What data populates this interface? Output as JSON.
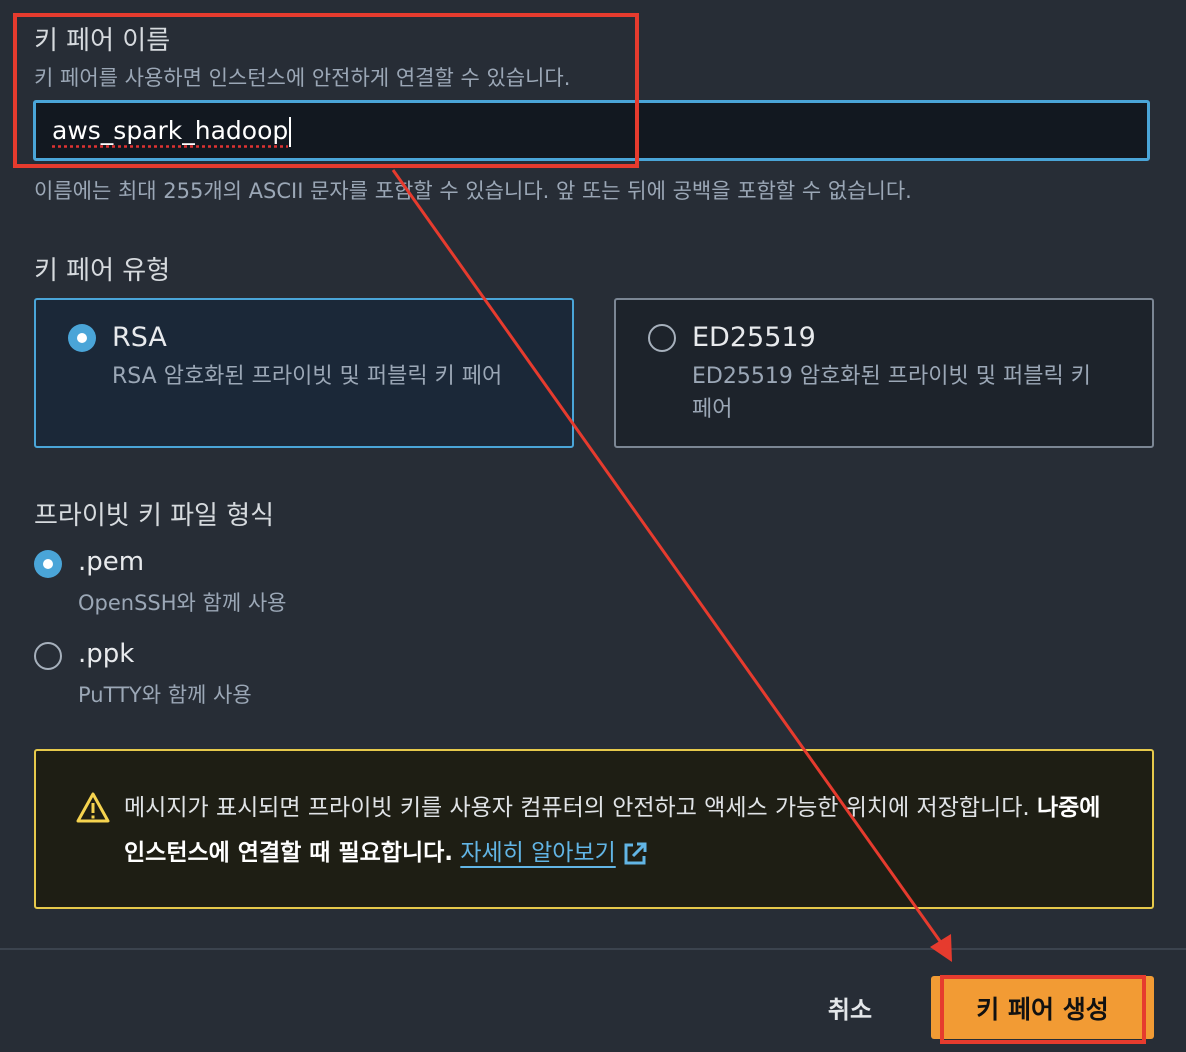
{
  "key_name": {
    "title": "키 페어 이름",
    "description": "키 페어를 사용하면 인스턴스에 안전하게 연결할 수 있습니다.",
    "input_value": "aws_spark_hadoop",
    "constraint": "이름에는 최대 255개의 ASCII 문자를 포함할 수 있습니다. 앞 또는 뒤에 공백을 포함할 수 없습니다."
  },
  "key_type": {
    "title": "키 페어 유형",
    "options": [
      {
        "label": "RSA",
        "description": "RSA 암호화된 프라이빗 및 퍼블릭 키 페어",
        "selected": true
      },
      {
        "label": "ED25519",
        "description": "ED25519 암호화된 프라이빗 및 퍼블릭 키 페어",
        "selected": false
      }
    ]
  },
  "file_format": {
    "title": "프라이빗 키 파일 형식",
    "options": [
      {
        "label": ".pem",
        "description": "OpenSSH와 함께 사용",
        "selected": true
      },
      {
        "label": ".ppk",
        "description": "PuTTY와 함께 사용",
        "selected": false
      }
    ]
  },
  "warning": {
    "text_1": "메시지가 표시되면 프라이빗 키를 사용자 컴퓨터의 안전하고 액세스 가능한 위치에 저장합니다. ",
    "text_bold": "나중에 인스턴스에 연결할 때 필요합니다.",
    "link_text": "자세히 알아보기",
    "icon": "warning-icon"
  },
  "footer": {
    "cancel_label": "취소",
    "create_label": "키 페어 생성"
  },
  "colors": {
    "background": "#272d36",
    "accent_blue": "#4aa5d8",
    "primary_button": "#f29b34",
    "warning_border": "#e6c94b",
    "annotation_red": "#e63b2e"
  }
}
